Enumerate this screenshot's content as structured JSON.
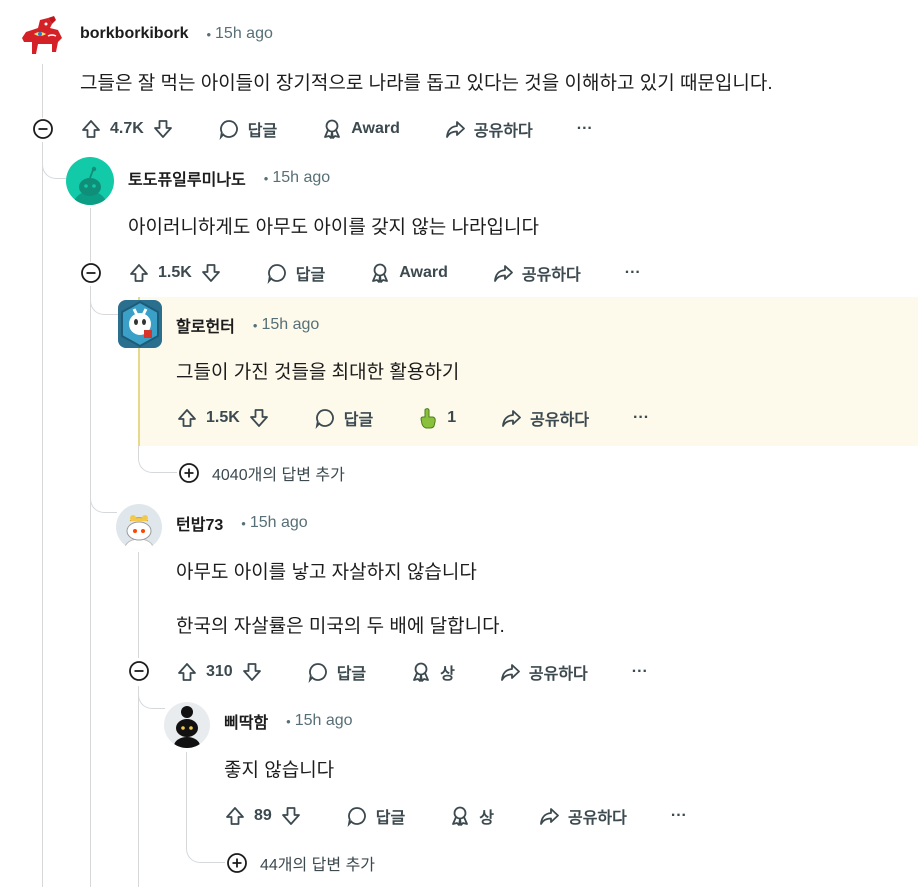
{
  "colors": {
    "thread_line": "#d6d9dc",
    "highlight_bg": "#fdf9eb",
    "highlight_border": "#e8d88c",
    "meta": "#576f76"
  },
  "comments": [
    {
      "author": "borkborkibork",
      "sep": "•",
      "time": "15h ago",
      "body": [
        "그들은 잘 먹는 아이들이 장기적으로 나라를 돕고 있다는 것을 이해하고 있기 때문입니다."
      ],
      "votes": "4.7K",
      "reply": "답글",
      "award": "Award",
      "share": "공유하다",
      "more": "···"
    },
    {
      "author": "토도퓨일루미나도",
      "sep": "•",
      "time": "15h ago",
      "body": [
        "아이러니하게도 아무도 아이를 갖지 않는 나라입니다"
      ],
      "votes": "1.5K",
      "reply": "답글",
      "award": "Award",
      "share": "공유하다",
      "more": "···"
    },
    {
      "author": "할로헌터",
      "sep": "•",
      "time": "15h ago",
      "body": [
        "그들이 가진 것들을 최대한 활용하기"
      ],
      "votes": "1.5K",
      "reply": "답글",
      "award_count": "1",
      "share": "공유하다",
      "more": "···"
    },
    {
      "author": "턴밥73",
      "sep": "•",
      "time": "15h ago",
      "body": [
        "아무도 아이를 낳고 자살하지 않습니다",
        "한국의 자살률은 미국의 두 배에 달합니다."
      ],
      "votes": "310",
      "reply": "답글",
      "award": "상",
      "share": "공유하다",
      "more": "···"
    },
    {
      "author": "삐딱함",
      "sep": "•",
      "time": "15h ago",
      "body": [
        "좋지 않습니다"
      ],
      "votes": "89",
      "reply": "답글",
      "award": "상",
      "share": "공유하다",
      "more": "···"
    }
  ],
  "more_replies": [
    "4040개의 답변 추가",
    "44개의 답변 추가"
  ]
}
